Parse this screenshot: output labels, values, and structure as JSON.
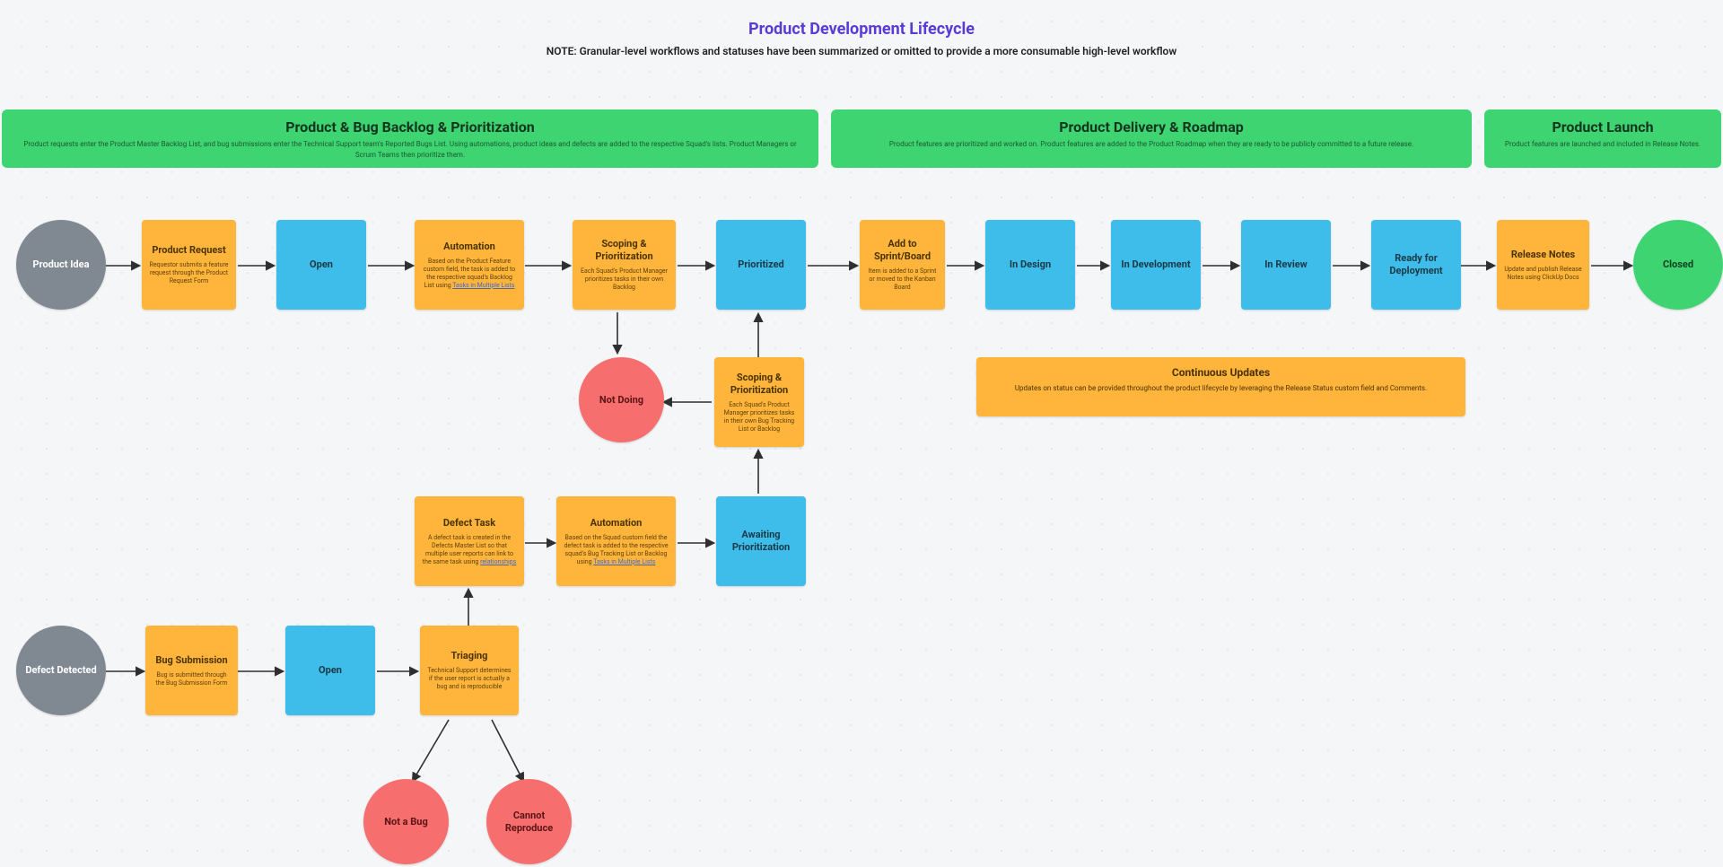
{
  "title": "Product Development Lifecycle",
  "subtitle": "NOTE: Granular-level workflows and statuses have been summarized or omitted to provide a more consumable high-level workflow",
  "lanes": {
    "backlog": {
      "title": "Product & Bug Backlog & Prioritization",
      "desc": "Product requests enter the Product Master Backlog List, and bug submissions enter the Technical Support team's Reported Bugs List. Using automations, product ideas and defects are added to the respective Squad's lists. Product Managers or Scrum Teams then prioritize them."
    },
    "delivery": {
      "title": "Product Delivery & Roadmap",
      "desc": "Product features are prioritized and worked on. Product features are added to the Product Roadmap when they are ready to be publicly committed to a future release."
    },
    "launch": {
      "title": "Product Launch",
      "desc": "Product features are launched and included in Release Notes."
    }
  },
  "nodes": {
    "product_idea": {
      "title": "Product Idea"
    },
    "product_request": {
      "title": "Product Request",
      "desc": "Requestor submits a feature request through the Product Request Form"
    },
    "open1": {
      "title": "Open"
    },
    "automation1": {
      "title": "Automation",
      "desc": "Based on the Product Feature custom field, the task is added to the respective squad's Backlog List using ",
      "link": "Tasks in Multiple Lists"
    },
    "scoping1": {
      "title": "Scoping & Prioritization",
      "desc": "Each Squad's Product Manager prioritizes tasks in their own Backlog"
    },
    "prioritized": {
      "title": "Prioritized"
    },
    "add_sprint": {
      "title": "Add to Sprint/Board",
      "desc": "Item is added to a Sprint or moved to the Kanban Board"
    },
    "in_design": {
      "title": "In Design"
    },
    "in_dev": {
      "title": "In Development"
    },
    "in_review": {
      "title": "In Review"
    },
    "ready_deploy": {
      "title": "Ready for Deployment"
    },
    "release_notes": {
      "title": "Release Notes",
      "desc": "Update and publish Release Notes using ClickUp Docs"
    },
    "closed": {
      "title": "Closed"
    },
    "not_doing": {
      "title": "Not Doing"
    },
    "scoping2": {
      "title": "Scoping & Prioritization",
      "desc": "Each Squad's Product Manager prioritizes tasks in their own Bug Tracking List or Backlog"
    },
    "defect_task": {
      "title": "Defect Task",
      "desc": "A defect task is created in the Defects Master List so that multiple user reports can link to the same task using ",
      "link": "relationships"
    },
    "automation2": {
      "title": "Automation",
      "desc": "Based on the Squad custom field the defect task is added to the respective squad's Bug Tracking List or Backlog using ",
      "link": "Tasks in Multiple Lists"
    },
    "awaiting": {
      "title": "Awaiting Prioritization"
    },
    "defect_detected": {
      "title": "Defect Detected"
    },
    "bug_submission": {
      "title": "Bug Submission",
      "desc": "Bug is submitted through the Bug Submission Form"
    },
    "open2": {
      "title": "Open"
    },
    "triaging": {
      "title": "Triaging",
      "desc": "Technical Support determines if the user report is actually a bug and is reproducible"
    },
    "not_a_bug": {
      "title": "Not a Bug"
    },
    "cannot_reproduce": {
      "title": "Cannot Reproduce"
    }
  },
  "updates": {
    "title": "Continuous Updates",
    "desc": "Updates on status can be provided throughout the product lifecycle by leveraging the Release Status custom field and Comments."
  }
}
